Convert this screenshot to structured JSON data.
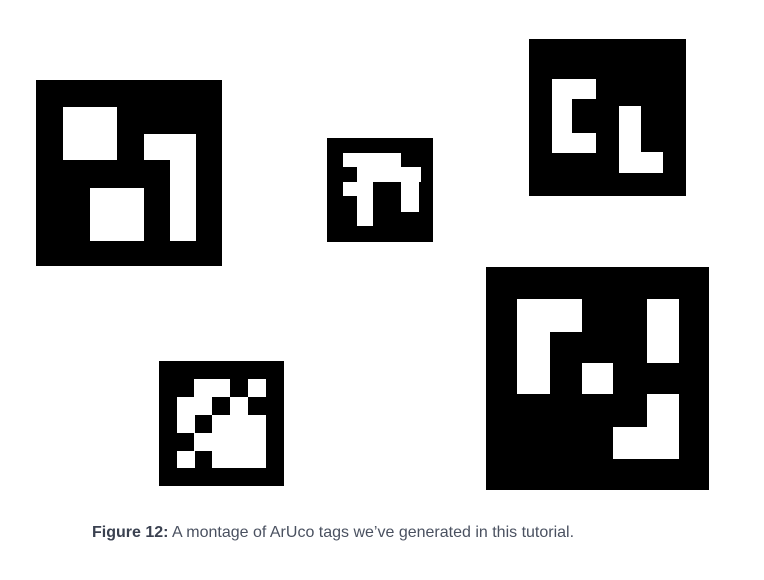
{
  "figure": {
    "caption_label": "Figure 12:",
    "caption_text": " A montage of ArUco tags we’ve generated in this tutorial."
  },
  "colors": {
    "tag_black": "#000000",
    "tag_white": "#ffffff",
    "caption_text": "#4a5160"
  }
}
